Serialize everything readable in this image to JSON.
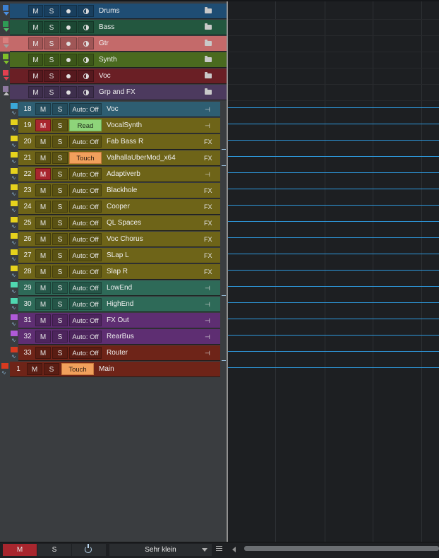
{
  "folders": [
    {
      "name": "Drums",
      "color": "#1f4d73",
      "chip": "#3b7fd0",
      "tri": "down",
      "triColor": "#4a8fe0",
      "open": false
    },
    {
      "name": "Bass",
      "color": "#23573f",
      "chip": "#2e9a55",
      "tri": "down",
      "triColor": "#4fc06a",
      "open": false
    },
    {
      "name": "Gtr",
      "color": "#c46a6a",
      "chip": "#d97f7f",
      "tri": "down",
      "triColor": "#a0a0a0",
      "open": false,
      "selected": true
    },
    {
      "name": "Synth",
      "color": "#4a6a1f",
      "chip": "#7fc02a",
      "tri": "down",
      "triColor": "#7fc02a",
      "open": false
    },
    {
      "name": "Voc",
      "color": "#6a1f25",
      "chip": "#e04050",
      "tri": "down",
      "triColor": "#e04050",
      "open": false
    },
    {
      "name": "Grp and FX",
      "color": "#4c3a5e",
      "chip": "#8e7aa0",
      "tri": "up",
      "triColor": "#c0c0c0",
      "open": true
    }
  ],
  "tracks": [
    {
      "num": "18",
      "name": "Voc",
      "auto": "Auto: Off",
      "mode": "off",
      "mRed": false,
      "icon": "bus",
      "color": "#2e5e72",
      "chip": "#3aa8d8"
    },
    {
      "num": "19",
      "name": "VocalSynth",
      "auto": "Read",
      "mode": "read",
      "mRed": true,
      "icon": "bus",
      "color": "#6e6418",
      "chip": "#e6d21c"
    },
    {
      "num": "20",
      "name": "Fab Bass R",
      "auto": "Auto: Off",
      "mode": "off",
      "mRed": false,
      "icon": "FX",
      "color": "#6e6418",
      "chip": "#e6d21c"
    },
    {
      "num": "21",
      "name": "ValhallaUberMod_x64",
      "auto": "Touch",
      "mode": "touch",
      "mRed": false,
      "icon": "FX",
      "color": "#6e6418",
      "chip": "#e6d21c"
    },
    {
      "num": "22",
      "name": "Adaptiverb",
      "auto": "Auto: Off",
      "mode": "off",
      "mRed": true,
      "icon": "bus",
      "color": "#6e6418",
      "chip": "#e6d21c"
    },
    {
      "num": "23",
      "name": "Blackhole",
      "auto": "Auto: Off",
      "mode": "off",
      "mRed": false,
      "icon": "FX",
      "color": "#6e6418",
      "chip": "#e6d21c"
    },
    {
      "num": "24",
      "name": "Cooper",
      "auto": "Auto: Off",
      "mode": "off",
      "mRed": false,
      "icon": "FX",
      "color": "#6e6418",
      "chip": "#e6d21c"
    },
    {
      "num": "25",
      "name": "QL Spaces",
      "auto": "Auto: Off",
      "mode": "off",
      "mRed": false,
      "icon": "FX",
      "color": "#6e6418",
      "chip": "#e6d21c"
    },
    {
      "num": "26",
      "name": "Voc Chorus",
      "auto": "Auto: Off",
      "mode": "off",
      "mRed": false,
      "icon": "FX",
      "color": "#6e6418",
      "chip": "#e6d21c"
    },
    {
      "num": "27",
      "name": "SLap L",
      "auto": "Auto: Off",
      "mode": "off",
      "mRed": false,
      "icon": "FX",
      "color": "#6e6418",
      "chip": "#e6d21c"
    },
    {
      "num": "28",
      "name": "Slap R",
      "auto": "Auto: Off",
      "mode": "off",
      "mRed": false,
      "icon": "FX",
      "color": "#6e6418",
      "chip": "#e6d21c"
    },
    {
      "num": "29",
      "name": "LowEnd",
      "auto": "Auto: Off",
      "mode": "off",
      "mRed": false,
      "icon": "bus",
      "color": "#2e6a58",
      "chip": "#4fd8b0"
    },
    {
      "num": "30",
      "name": "HighEnd",
      "auto": "Auto: Off",
      "mode": "off",
      "mRed": false,
      "icon": "bus",
      "color": "#2e6a58",
      "chip": "#4fd8b0"
    },
    {
      "num": "31",
      "name": "FX Out",
      "auto": "Auto: Off",
      "mode": "off",
      "mRed": false,
      "icon": "bus",
      "color": "#5e2e72",
      "chip": "#b05ad8"
    },
    {
      "num": "32",
      "name": "RearBus",
      "auto": "Auto: Off",
      "mode": "off",
      "mRed": false,
      "icon": "bus",
      "color": "#5e2e72",
      "chip": "#b05ad8"
    },
    {
      "num": "33",
      "name": "Router",
      "auto": "Auto: Off",
      "mode": "off",
      "mRed": false,
      "icon": "bus",
      "color": "#6e2418",
      "chip": "#d83a20"
    }
  ],
  "main": {
    "num": "1",
    "name": "Main",
    "auto": "Touch",
    "mode": "touch",
    "color": "#6e2418",
    "chip": "#d83a20"
  },
  "labels": {
    "mute": "M",
    "solo": "S",
    "fx": "FX"
  },
  "bottombar": {
    "mute": "M",
    "solo": "S",
    "size": "Sehr klein"
  }
}
